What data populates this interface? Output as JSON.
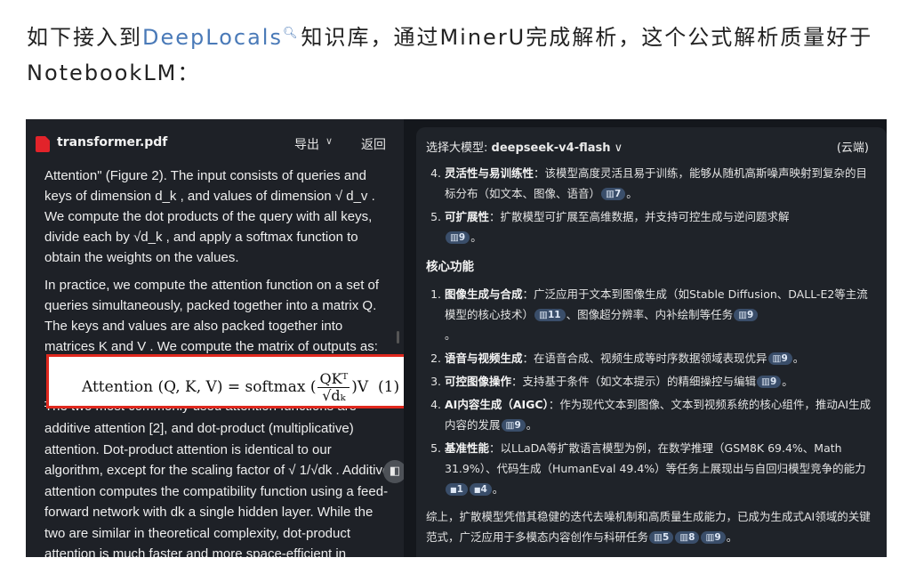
{
  "intro": {
    "before": "如下接入到",
    "link": "DeepLocals",
    "search_icon": "search-icon",
    "after": "知识库，通过MinerU完成解析，这个公式解析质量好于NotebookLM："
  },
  "pdf": {
    "file_name": "transformer.pdf",
    "export_label": "导出",
    "back_label": "返回",
    "para1": "Attention\" (Figure 2). The input consists of queries and keys of dimension d_k , and values of dimension √ d_v . We compute the dot products of the query with all keys, divide each by √d_k , and apply a softmax function to obtain the weights on the values.",
    "para2": "In practice, we compute the attention function on a set of queries simultaneously, packed together into a matrix Q. The keys and values are also packed together into matrices K and V . We compute the matrix of outputs as:",
    "formula": {
      "lhs": "Attention (Q, K, V) =  softmax (",
      "numerator": "QKᵀ",
      "denominator": "√dₖ",
      "rhs": ")V",
      "number": "(1)"
    },
    "struck_line": "The two most commonly used attention functions are",
    "para3": "additive attention [2], and dot-product (multiplicative) attention. Dot-product attention is identical to our algorithm, except for the scaling factor of √ 1/√dk . Additive attention computes the compatibility function using a feed-forward network with dk a single hidden layer. While the two are similar in theoretical complexity, dot-product attention is much faster and more space-efficient in"
  },
  "chat": {
    "model_prefix": "选择大模型: ",
    "model_name": "deepseek-v4-flash",
    "cloud_label": "(云端)",
    "top_items": [
      {
        "title": "灵活性与易训练性",
        "text": "：该模型高度灵活且易于训练，能够从随机高斯噪声映射到复杂的目标分布（如文本、图像、语音）",
        "cites": [
          "7"
        ]
      },
      {
        "title": "可扩展性",
        "text": "：扩散模型可扩展至高维数据，并支持可控生成与逆问题求解",
        "cites": [
          "9"
        ]
      }
    ],
    "section_title": "核心功能",
    "core_items": [
      {
        "title": "图像生成与合成",
        "text": "：广泛应用于文本到图像生成（如Stable Diffusion、DALL-E2等主流模型的核心技术）",
        "cites": [
          "11"
        ],
        "text2": "、图像超分辨率、内补绘制等任务",
        "cites2": [
          "9"
        ],
        "tail": "。"
      },
      {
        "title": "语音与视频生成",
        "text": "：在语音合成、视频生成等时序数据领域表现优异",
        "cites": [
          "9"
        ],
        "text2": "。"
      },
      {
        "title": "可控图像操作",
        "text": "：支持基于条件（如文本提示）的精细操控与编辑",
        "cites": [
          "9"
        ],
        "text2": "。"
      },
      {
        "title": "AI内容生成（AIGC）",
        "text": "：作为现代文本到图像、文本到视频系统的核心组件，推动AI生成内容的发展",
        "cites": [
          "9"
        ],
        "text2": "。"
      },
      {
        "title": "基准性能",
        "text": "：以LLaDA等扩散语言模型为例，在数学推理（GSM8K 69.4%、Math 31.9%）、代码生成（HumanEval 49.4%）等任务上展现出与自回归模型竞争的能力",
        "doc_cites": [
          "1",
          "4"
        ],
        "text2": "。"
      }
    ],
    "summary": "综上，扩散模型凭借其稳健的迭代去噪机制和高质量生成能力，已成为生成式AI领域的关键范式，广泛应用于多模态内容创作与科研任务",
    "summary_cites": [
      "5",
      "8",
      "9"
    ],
    "summary_end": "。"
  }
}
